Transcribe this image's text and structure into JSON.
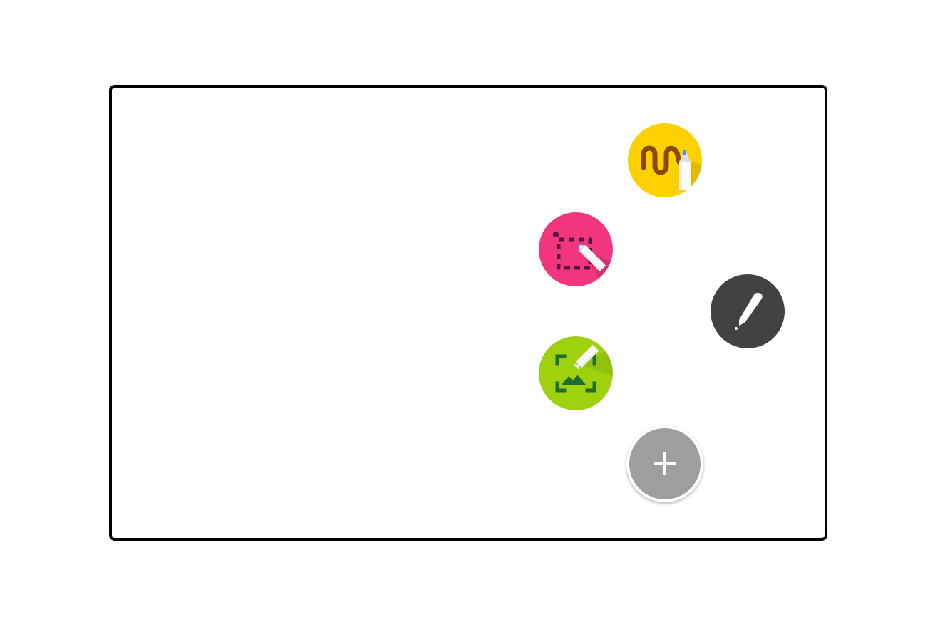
{
  "colors": {
    "frame": "#000000",
    "yellow": "#FDD000",
    "pink": "#F2367E",
    "green": "#9FD10F",
    "dark": "#424242",
    "gray": "#9E9E9E",
    "squiggle": "#8B4A00",
    "crop_dash": "#5E1042",
    "image_frame": "#1B6E2E"
  },
  "actions": [
    {
      "name": "sketch",
      "icon": "squiggle-pen-icon",
      "color": "yellow"
    },
    {
      "name": "screen-snip",
      "icon": "crop-snip-pen-icon",
      "color": "pink"
    },
    {
      "name": "annotate-image",
      "icon": "image-capture-pen-icon",
      "color": "green"
    },
    {
      "name": "pen",
      "icon": "pen-icon",
      "color": "dark"
    }
  ],
  "add_button": {
    "icon": "plus-icon",
    "label": "+"
  }
}
